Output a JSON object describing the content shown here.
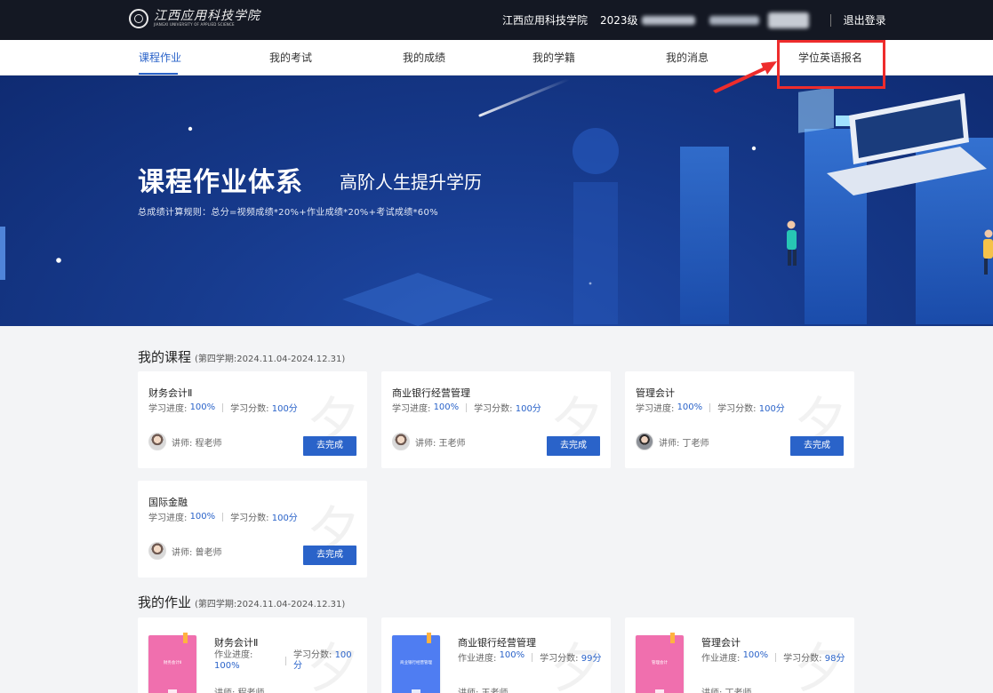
{
  "header": {
    "logo_text": "江西应用科技学院",
    "logo_subtitle": "JIANGXI UNIVERSITY OF APPLIED SCIENCE",
    "school": "江西应用科技学院",
    "grade": "2023级",
    "logout": "退出登录"
  },
  "nav": {
    "items": [
      "课程作业",
      "我的考试",
      "我的成绩",
      "我的学籍",
      "我的消息",
      "学位英语报名"
    ],
    "active": "课程作业",
    "highlight_color": "#ee2c2c",
    "accent_color": "#2a63c9"
  },
  "banner": {
    "title": "课程作业体系",
    "subtitle": "高阶人生提升学历",
    "rule": "总成绩计算规则：总分=视频成绩*20%+作业成绩*20%+考试成绩*60%"
  },
  "courses": {
    "title": "我的课程",
    "term": "(第四学期:2024.11.04-2024.12.31)",
    "progress_label": "学习进度:",
    "score_label": "学习分数:",
    "button_label": "去完成",
    "items": [
      {
        "name": "财务会计Ⅱ",
        "progress": "100%",
        "score": "100分",
        "teacher": "讲师: 程老师"
      },
      {
        "name": "商业银行经营管理",
        "progress": "100%",
        "score": "100分",
        "teacher": "讲师: 王老师"
      },
      {
        "name": "管理会计",
        "progress": "100%",
        "score": "100分",
        "teacher": "讲师: 丁老师"
      },
      {
        "name": "国际金融",
        "progress": "100%",
        "score": "100分",
        "teacher": "讲师: 曾老师"
      }
    ]
  },
  "homework": {
    "title": "我的作业",
    "term": "(第四学期:2024.11.04-2024.12.31)",
    "progress_label": "作业进度:",
    "score_label": "学习分数:",
    "items": [
      {
        "name": "财务会计Ⅱ",
        "book_title": "财务会计Ⅱ",
        "book_color": "#f06fae",
        "progress": "100%",
        "score": "100分",
        "teacher": "讲师: 程老师"
      },
      {
        "name": "商业银行经营管理",
        "book_title": "商业银行经营管理",
        "book_color": "#4f7df2",
        "progress": "100%",
        "score": "99分",
        "teacher": "讲师: 王老师"
      },
      {
        "name": "管理会计",
        "book_title": "管理会计",
        "book_color": "#f06fae",
        "progress": "100%",
        "score": "98分",
        "teacher": "讲师: 丁老师"
      }
    ]
  }
}
